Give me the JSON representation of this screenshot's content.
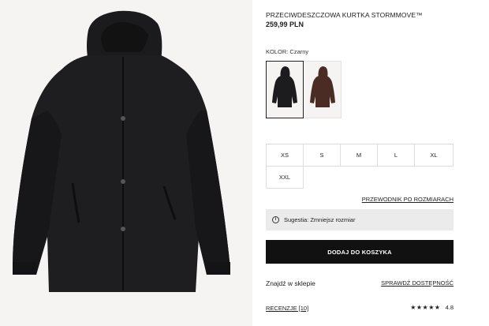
{
  "product": {
    "title": "PRZECIWDESZCZOWA KURTKA STORMMOVE™",
    "price": "259,99 PLN",
    "image_icon": "black-rain-jacket-image"
  },
  "color": {
    "label": "KOLOR: Czarny",
    "swatches": [
      {
        "name": "black",
        "hex": "#1c1c1e",
        "selected": true
      },
      {
        "name": "brown",
        "hex": "#4a2c24",
        "selected": false
      }
    ]
  },
  "sizes": {
    "options": [
      "XS",
      "S",
      "M",
      "L",
      "XL",
      "XXL"
    ]
  },
  "size_guide": {
    "label": "PRZEWODNIK PO ROZMIARACH"
  },
  "suggestion": {
    "icon": "info-icon",
    "text": "Sugestia: Zmniejsz rozmiar"
  },
  "actions": {
    "add_to_cart": "DODAJ DO KOSZYKA"
  },
  "store": {
    "find_label": "Znajdź w sklepie",
    "check_label": "SPRAWDŹ DOSTĘPNOŚĆ"
  },
  "reviews": {
    "label": "RECENZJE [10]",
    "stars": "★★★★★",
    "rating": "4.8"
  }
}
